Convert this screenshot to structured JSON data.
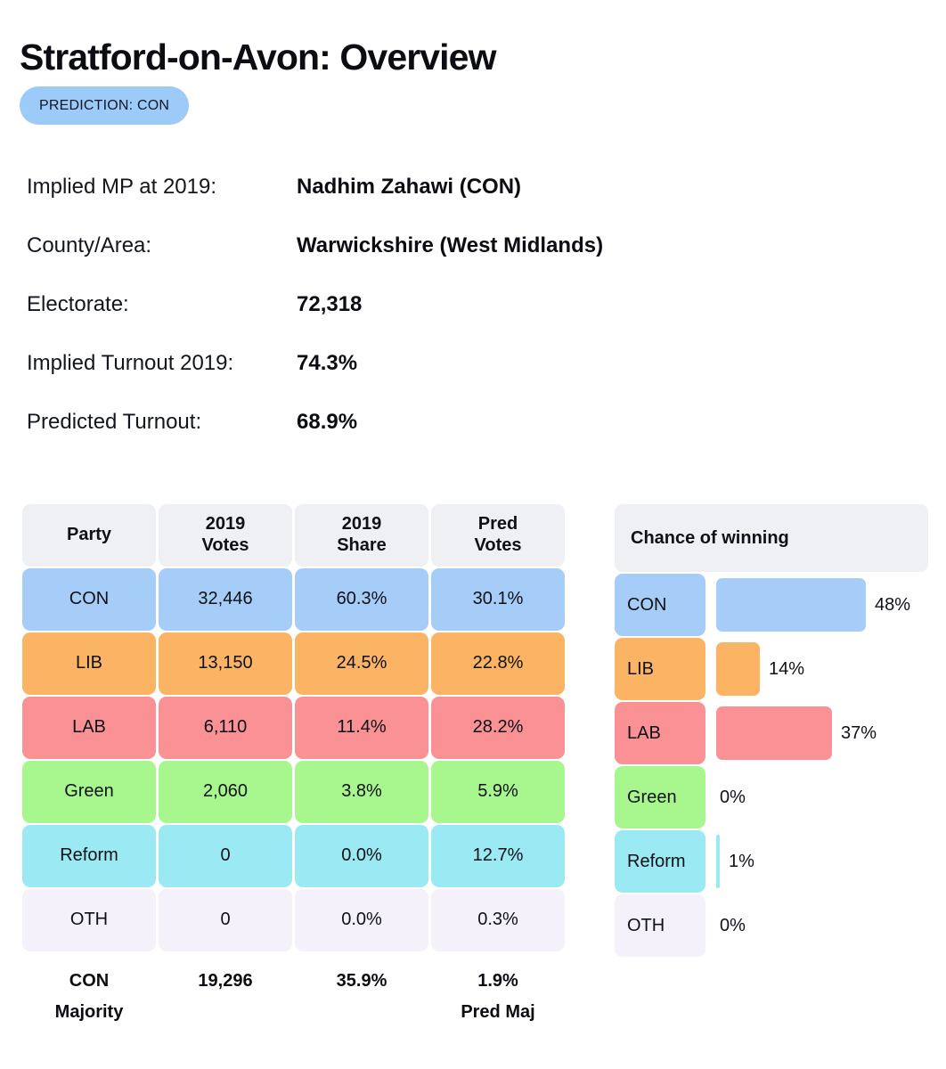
{
  "header": {
    "title": "Stratford-on-Avon: Overview",
    "prediction_badge": "PREDICTION: CON",
    "badge_color": "#9ccbfa"
  },
  "info": [
    {
      "label": "Implied MP at 2019:",
      "value": "Nadhim Zahawi  (CON)"
    },
    {
      "label": "County/Area:",
      "value": "Warwickshire (West Midlands)"
    },
    {
      "label": "Electorate:",
      "value": "72,318"
    },
    {
      "label": "Implied Turnout 2019:",
      "value": "74.3%"
    },
    {
      "label": "Predicted Turnout:",
      "value": "68.9%"
    }
  ],
  "results_table": {
    "columns": [
      "Party",
      "2019\nVotes",
      "2019\nShare",
      "Pred\nVotes"
    ],
    "rows": [
      {
        "party": "CON",
        "votes_2019": "32,446",
        "share_2019": "60.3%",
        "pred_votes": "30.1%",
        "color": "#a6cdf7"
      },
      {
        "party": "LIB",
        "votes_2019": "13,150",
        "share_2019": "24.5%",
        "pred_votes": "22.8%",
        "color": "#fbb464"
      },
      {
        "party": "LAB",
        "votes_2019": "6,110",
        "share_2019": "11.4%",
        "pred_votes": "28.2%",
        "color": "#fa9195"
      },
      {
        "party": "Green",
        "votes_2019": "2,060",
        "share_2019": "3.8%",
        "pred_votes": "5.9%",
        "color": "#a8f78e"
      },
      {
        "party": "Reform",
        "votes_2019": "0",
        "share_2019": "0.0%",
        "pred_votes": "12.7%",
        "color": "#9ae9f3"
      },
      {
        "party": "OTH",
        "votes_2019": "0",
        "share_2019": "0.0%",
        "pred_votes": "0.3%",
        "color": "#f4f1fb"
      }
    ],
    "footer": {
      "majority_party": "CON",
      "majority_word": "Majority",
      "majority_votes": "19,296",
      "majority_share": "35.9%",
      "pred_majority": "1.9%",
      "pred_majority_label": "Pred Maj"
    }
  },
  "chance_of_winning": {
    "title": "Chance of winning",
    "rows": [
      {
        "party": "CON",
        "value": "48%",
        "pct": 48,
        "color": "#a6cdf7"
      },
      {
        "party": "LIB",
        "value": "14%",
        "pct": 14,
        "color": "#fbb464"
      },
      {
        "party": "LAB",
        "value": "37%",
        "pct": 37,
        "color": "#fa9195"
      },
      {
        "party": "Green",
        "value": "0%",
        "pct": 0,
        "color": "#a8f78e"
      },
      {
        "party": "Reform",
        "value": "1%",
        "pct": 1,
        "color": "#9ae9f3"
      },
      {
        "party": "OTH",
        "value": "0%",
        "pct": 0,
        "color": "#f4f1fb"
      }
    ]
  },
  "chart_data": {
    "type": "bar",
    "title": "Chance of winning",
    "orientation": "horizontal",
    "categories": [
      "CON",
      "LIB",
      "LAB",
      "Green",
      "Reform",
      "OTH"
    ],
    "values": [
      48,
      14,
      37,
      0,
      1,
      0
    ],
    "value_labels": [
      "48%",
      "14%",
      "37%",
      "0%",
      "1%",
      "0%"
    ],
    "colors": [
      "#a6cdf7",
      "#fbb464",
      "#fa9195",
      "#a8f78e",
      "#9ae9f3",
      "#f4f1fb"
    ],
    "xlabel": "",
    "ylabel": "",
    "xlim": [
      0,
      100
    ],
    "grid": false,
    "legend": "none",
    "units": "percent"
  }
}
